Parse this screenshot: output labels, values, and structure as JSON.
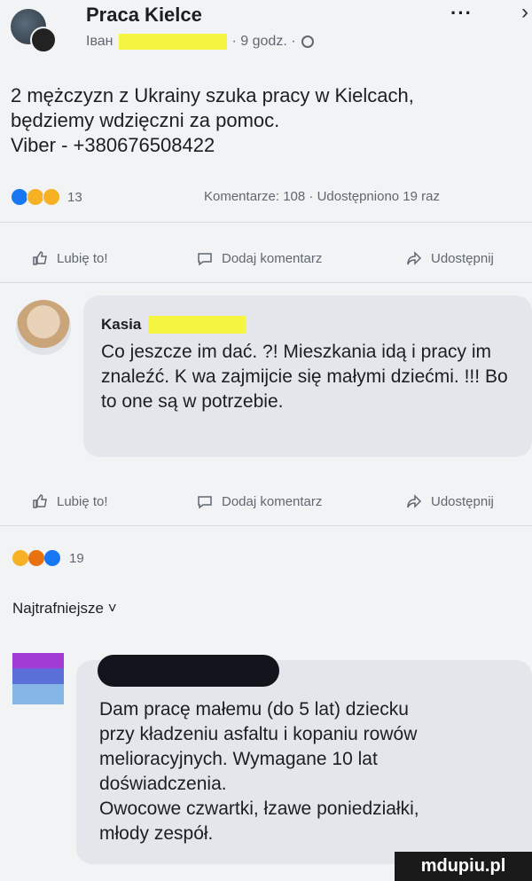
{
  "header": {
    "group_name": "Praca Kielce",
    "author_prefix": "Іван",
    "time": "· 9 godz. ·",
    "more": "···",
    "close": "›"
  },
  "post": {
    "text": "2 mężczyzn z Ukrainy szuka pracy w Kielcach,\nbędziemy wdzięczni za pomoc.\nViber - +380676508422"
  },
  "post_stats": {
    "reactions_count": "13",
    "stats_text": "Komentarze: 108 · Udostępniono 19 raz"
  },
  "actions": {
    "like": "Lubię to!",
    "comment": "Dodaj komentarz",
    "share": "Udostępnij"
  },
  "comment1": {
    "author": "Kasia",
    "text": "Co jeszcze im dać. ?! Mieszkania idą i pracy im znaleźć. K  wa zajmijcie się małymi dziećmi. !!! Bo to one są w potrzebie."
  },
  "comment1_stats": {
    "reactions_count": "19"
  },
  "sort": {
    "label": "Najtrafniejsze ˅"
  },
  "comment2": {
    "text": "Dam pracę małemu (do 5 lat) dziecku\nprzy kładzeniu asfaltu i kopaniu rowów\nmelioracyjnych. Wymagane 10 lat\ndoświadczenia.\nOwocowe czwartki, łzawe poniedziałki,\nmłody zespół."
  },
  "watermark": "mdupiu.pl",
  "colors": {
    "bg": "#f2f3f5",
    "bubble": "#e4e6eb",
    "text_secondary": "#606770",
    "redact": "#f5f542"
  }
}
